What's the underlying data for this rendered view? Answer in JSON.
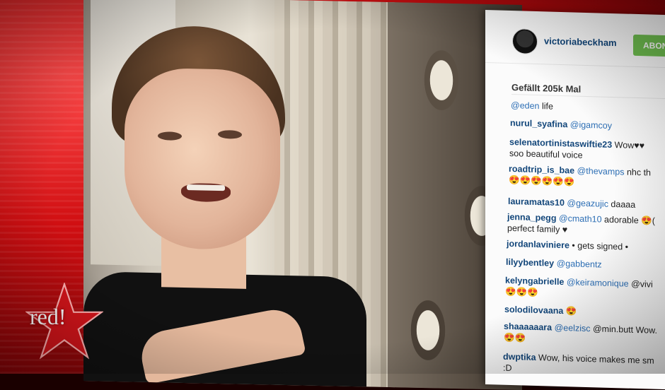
{
  "logo": {
    "text": "red!"
  },
  "post": {
    "username": "victoriabeckham",
    "follow_label": "ABON",
    "likes": "Gefällt 205k Mal"
  },
  "comments": [
    {
      "user": "",
      "mention": "@eden",
      "text": "life",
      "line2": ""
    },
    {
      "user": "nurul_syafina",
      "mention": "@igamcoy",
      "text": "",
      "line2": ""
    },
    {
      "user": "selenatortinistaswiftie23",
      "mention": "",
      "text": "Wow♥♥",
      "line2": "soo beautiful voice"
    },
    {
      "user": "roadtrip_is_bae",
      "mention": "@thevamps",
      "text": "nhc th",
      "line2": "😍😍😍😍😍😍"
    },
    {
      "user": "lauramatas10",
      "mention": "@geazujic",
      "text": "daaaa",
      "line2": ""
    },
    {
      "user": "jenna_pegg",
      "mention": "@cmath10",
      "text": "adorable 😍(",
      "line2": "perfect family ♥"
    },
    {
      "user": "jordanlaviniere",
      "mention": "",
      "text": "• gets signed •",
      "line2": ""
    },
    {
      "user": "lilyybentley",
      "mention": "@gabbentz",
      "text": "",
      "line2": ""
    },
    {
      "user": "kelyngabrielle",
      "mention": "@keiramonique",
      "text": "@vivi",
      "line2": "😍😍😍"
    },
    {
      "user": "solodilovaana",
      "mention": "",
      "text": "😍",
      "line2": ""
    },
    {
      "user": "shaaaaaara",
      "mention": "@eelzisc",
      "text": "@min.butt Wow.",
      "line2": "😍😍"
    },
    {
      "user": "dwptika",
      "mention": "",
      "text": "Wow, his voice makes me sm",
      "line2": ":D"
    }
  ]
}
